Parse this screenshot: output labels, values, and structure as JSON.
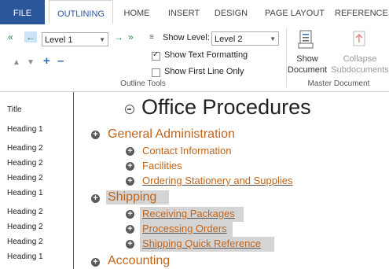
{
  "tabs": [
    {
      "label": "FILE"
    },
    {
      "label": "OUTLINING"
    },
    {
      "label": "HOME"
    },
    {
      "label": "INSERT"
    },
    {
      "label": "DESIGN"
    },
    {
      "label": "PAGE LAYOUT"
    },
    {
      "label": "REFERENCES"
    }
  ],
  "ribbon": {
    "outline_tools": {
      "level_value": "Level 1",
      "show_level_label": "Show Level:",
      "show_level_value": "Level 2",
      "show_text_formatting_label": "Show Text Formatting",
      "show_text_formatting_checked": true,
      "show_first_line_only_label": "Show First Line Only",
      "show_first_line_only_checked": false,
      "group_label": "Outline Tools"
    },
    "master_document": {
      "show_document_line1": "Show",
      "show_document_line2": "Document",
      "collapse_subdocuments_line1": "Collapse",
      "collapse_subdocuments_line2": "Subdocuments",
      "group_label": "Master Document"
    }
  },
  "style_column": [
    "Title",
    "Heading 1",
    "Heading 2",
    "Heading 2",
    "Heading 2",
    "Heading 1",
    "Heading 2",
    "Heading 2",
    "Heading 2",
    "Heading 1"
  ],
  "outline": {
    "title": "Office Procedures",
    "items": [
      {
        "text": "General Administration"
      },
      {
        "text": "Contact Information"
      },
      {
        "text": "Facilities"
      },
      {
        "text": "Ordering Stationery and Supplies"
      },
      {
        "text": "Shipping"
      },
      {
        "text": "Receiving Packages"
      },
      {
        "text": "Processing Orders"
      },
      {
        "text": "Shipping Quick Reference"
      },
      {
        "text": "Accounting"
      }
    ]
  }
}
